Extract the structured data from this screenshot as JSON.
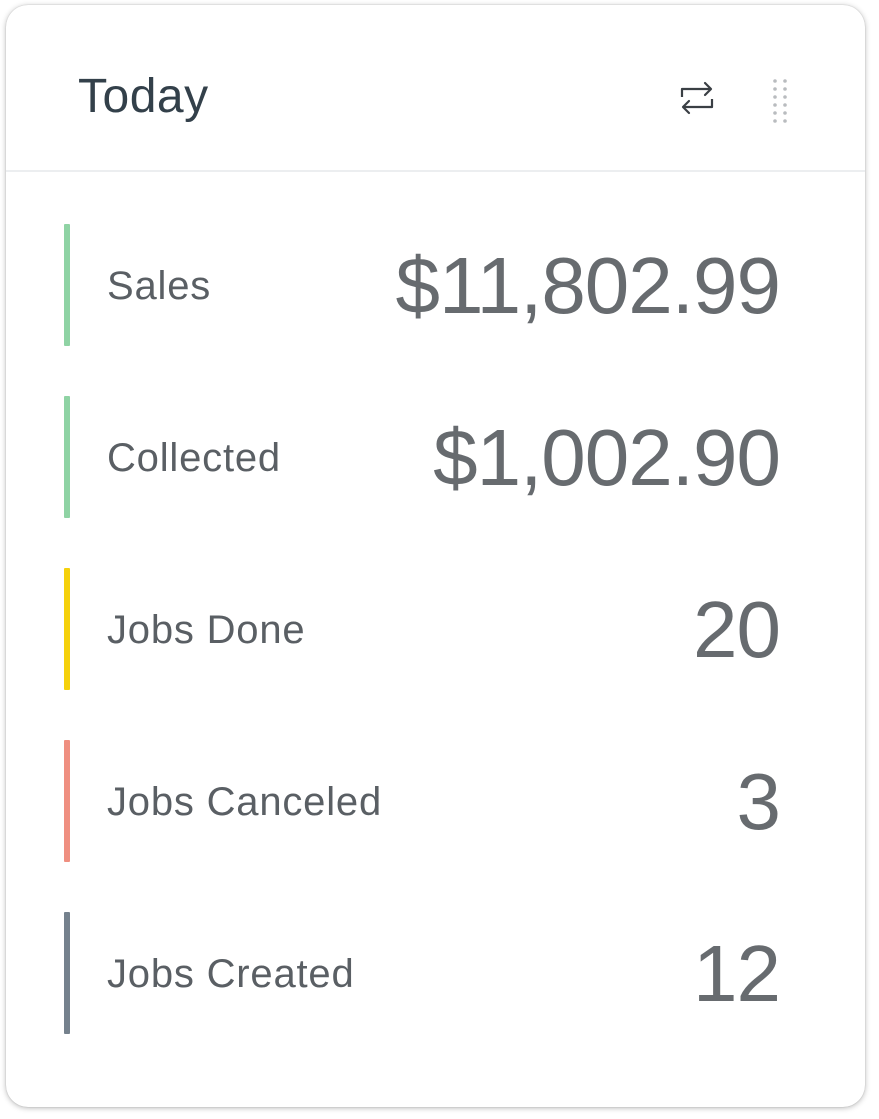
{
  "header": {
    "title": "Today",
    "refresh_icon": "refresh-icon",
    "drag_icon": "drag-handle-icon"
  },
  "metrics": [
    {
      "label": "Sales",
      "value": "$11,802.99",
      "color": "#8fd3a4"
    },
    {
      "label": "Collected",
      "value": "$1,002.90",
      "color": "#8fd3a4"
    },
    {
      "label": "Jobs Done",
      "value": "20",
      "color": "#f5d10c"
    },
    {
      "label": "Jobs Canceled",
      "value": "3",
      "color": "#ef8f80"
    },
    {
      "label": "Jobs Created",
      "value": "12",
      "color": "#75818d"
    }
  ]
}
